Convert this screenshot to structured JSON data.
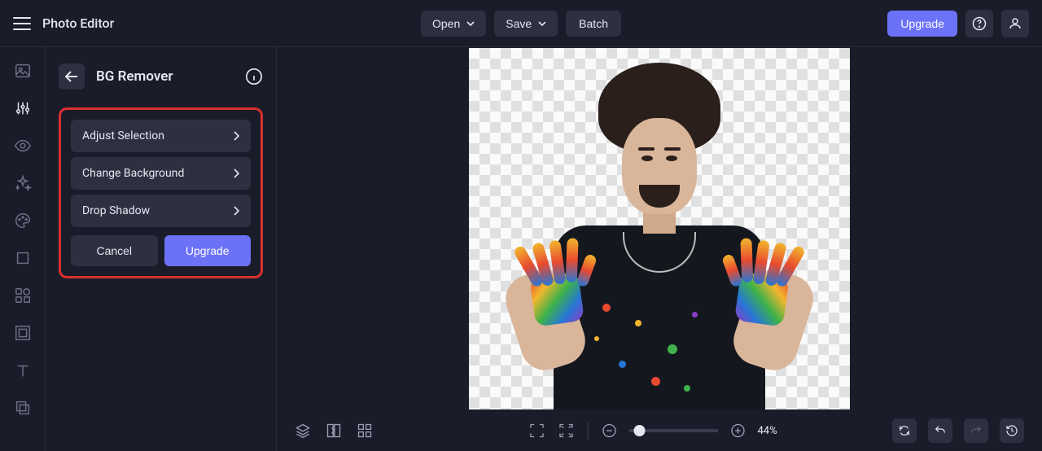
{
  "app_title": "Photo Editor",
  "topbar": {
    "open_label": "Open",
    "save_label": "Save",
    "batch_label": "Batch",
    "upgrade_label": "Upgrade"
  },
  "panel": {
    "title": "BG Remover",
    "options": {
      "adjust": "Adjust Selection",
      "change_bg": "Change Background",
      "drop_shadow": "Drop Shadow"
    },
    "cancel_label": "Cancel",
    "upgrade_label": "Upgrade"
  },
  "zoom": {
    "percent_label": "44%"
  },
  "toolrail_icons": [
    "image",
    "adjust",
    "eye",
    "sparkle",
    "palette",
    "crop",
    "shapes",
    "frame",
    "text",
    "overlay"
  ],
  "colors": {
    "accent": "#6b72f8",
    "highlight_box": "#d93030"
  }
}
